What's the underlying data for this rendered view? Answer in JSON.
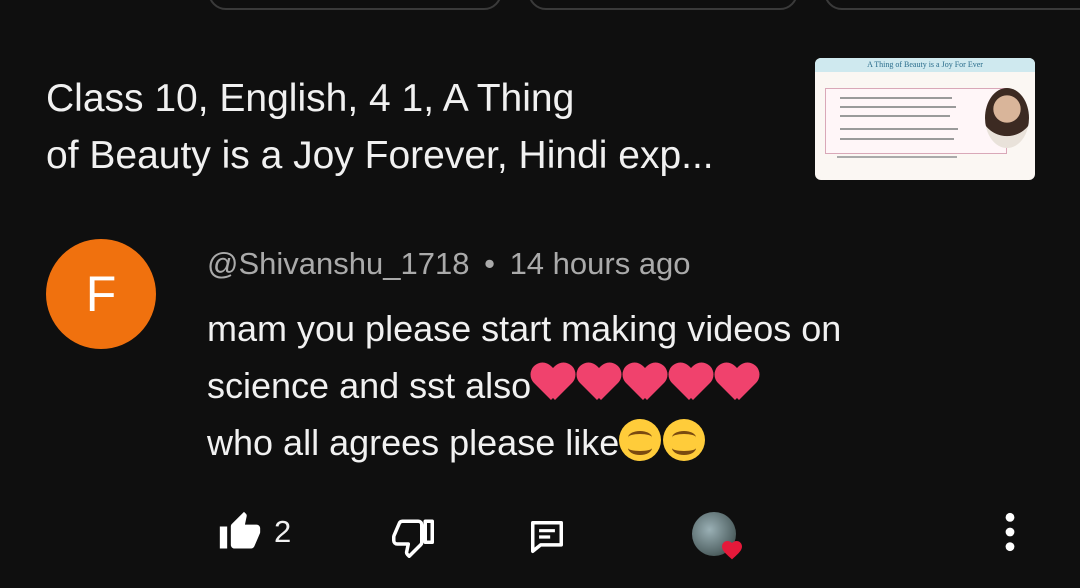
{
  "video": {
    "title_line1": "Class 10, English, 4 1, A Thing",
    "title_line2": "of Beauty is a Joy Forever, Hindi exp...",
    "thumbnail_heading": "A Thing of Beauty is a Joy For Ever"
  },
  "comment": {
    "avatar_letter": "F",
    "author": "@Shivanshu_1718",
    "separator": "•",
    "time": "14 hours ago",
    "line1": "mam you please start making videos on",
    "line2_text": "science and sst also",
    "line3_text": "who all agrees please like",
    "line2_emoji": [
      "heart",
      "heart",
      "heart",
      "heart",
      "heart"
    ],
    "line3_emoji": [
      "smiling-face",
      "smiling-face"
    ]
  },
  "actions": {
    "like_count": "2",
    "icons": {
      "like": "thumbs-up-icon",
      "dislike": "thumbs-down-icon",
      "reply": "reply-comment-icon",
      "creator_heart": "creator-heart-icon",
      "more": "more-vert-icon"
    }
  },
  "colors": {
    "background": "#0f0f0f",
    "avatar": "#f0710e",
    "heart": "#f0426d",
    "creator_heart": "#e5193a"
  }
}
